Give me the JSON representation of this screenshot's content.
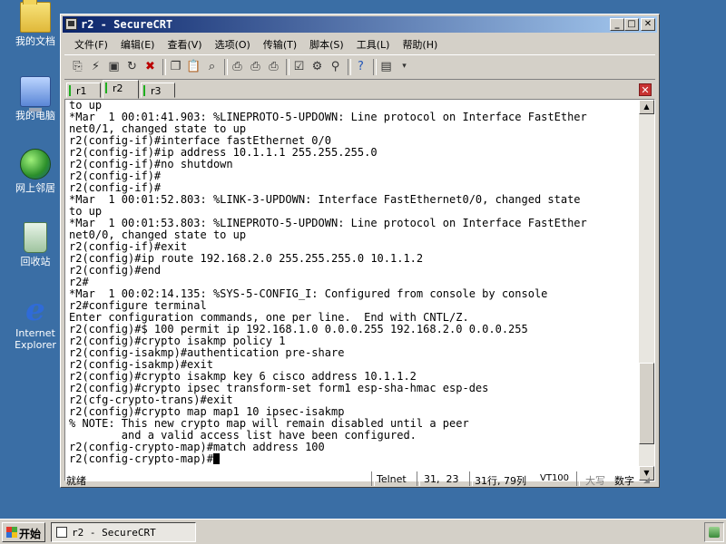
{
  "desktop": {
    "icons": [
      {
        "label": "我的文档",
        "icon": "my-documents-icon"
      },
      {
        "label": "我的电脑",
        "icon": "my-computer-icon"
      },
      {
        "label": "网上邻居",
        "icon": "network-places-icon"
      },
      {
        "label": "回收站",
        "icon": "recycle-bin-icon"
      },
      {
        "label": "Internet Explorer",
        "icon": "internet-explorer-icon"
      }
    ]
  },
  "window": {
    "title": "r2 - SecureCRT",
    "controls": {
      "minimize": "_",
      "maximize": "□",
      "close": "✕"
    }
  },
  "menu": [
    "文件(F)",
    "编辑(E)",
    "查看(V)",
    "选项(O)",
    "传输(T)",
    "脚本(S)",
    "工具(L)",
    "帮助(H)"
  ],
  "toolbar_icons": [
    "connect-icon",
    "quick-connect-icon",
    "connect-tab-icon",
    "reconnect-icon",
    "disconnect-icon",
    "copy-icon",
    "paste-icon",
    "find-icon",
    "print-icon",
    "print-selection-icon",
    "print-setup-icon",
    "session-options-icon",
    "global-options-icon",
    "keymap-icon",
    "help-icon",
    "sftp-icon"
  ],
  "tabs": [
    "r1",
    "r2",
    "r3"
  ],
  "active_tab": "r2",
  "terminal_lines": [
    "to up",
    "*Mar  1 00:01:41.903: %LINEPROTO-5-UPDOWN: Line protocol on Interface FastEther",
    "net0/1, changed state to up",
    "r2(config-if)#interface fastEthernet 0/0",
    "r2(config-if)#ip address 10.1.1.1 255.255.255.0",
    "r2(config-if)#no shutdown",
    "r2(config-if)#",
    "r2(config-if)#",
    "*Mar  1 00:01:52.803: %LINK-3-UPDOWN: Interface FastEthernet0/0, changed state",
    "to up",
    "*Mar  1 00:01:53.803: %LINEPROTO-5-UPDOWN: Line protocol on Interface FastEther",
    "net0/0, changed state to up",
    "r2(config-if)#exit",
    "r2(config)#ip route 192.168.2.0 255.255.255.0 10.1.1.2",
    "r2(config)#end",
    "r2#",
    "*Mar  1 00:02:14.135: %SYS-5-CONFIG_I: Configured from console by console",
    "r2#configure terminal",
    "Enter configuration commands, one per line.  End with CNTL/Z.",
    "r2(config)#$ 100 permit ip 192.168.1.0 0.0.0.255 192.168.2.0 0.0.0.255",
    "r2(config)#crypto isakmp policy 1",
    "r2(config-isakmp)#authentication pre-share",
    "r2(config-isakmp)#exit",
    "r2(config)#crypto isakmp key 6 cisco address 10.1.1.2",
    "r2(config)#crypto ipsec transform-set form1 esp-sha-hmac esp-des",
    "r2(cfg-crypto-trans)#exit",
    "r2(config)#crypto map map1 10 ipsec-isakmp",
    "% NOTE: This new crypto map will remain disabled until a peer",
    "        and a valid access list have been configured.",
    "r2(config-crypto-map)#match address 100",
    "r2(config-crypto-map)#"
  ],
  "status": {
    "ready": "就绪",
    "protocol": "Telnet",
    "cursor_pos": "31,  23",
    "row_col": "31行, 79列",
    "terminal_type": "VT100",
    "caps": "大写",
    "num": "数字"
  },
  "taskbar": {
    "start_label": "开始",
    "task_label": "r2 - SecureCRT"
  },
  "scrollbar_position": 0.92
}
